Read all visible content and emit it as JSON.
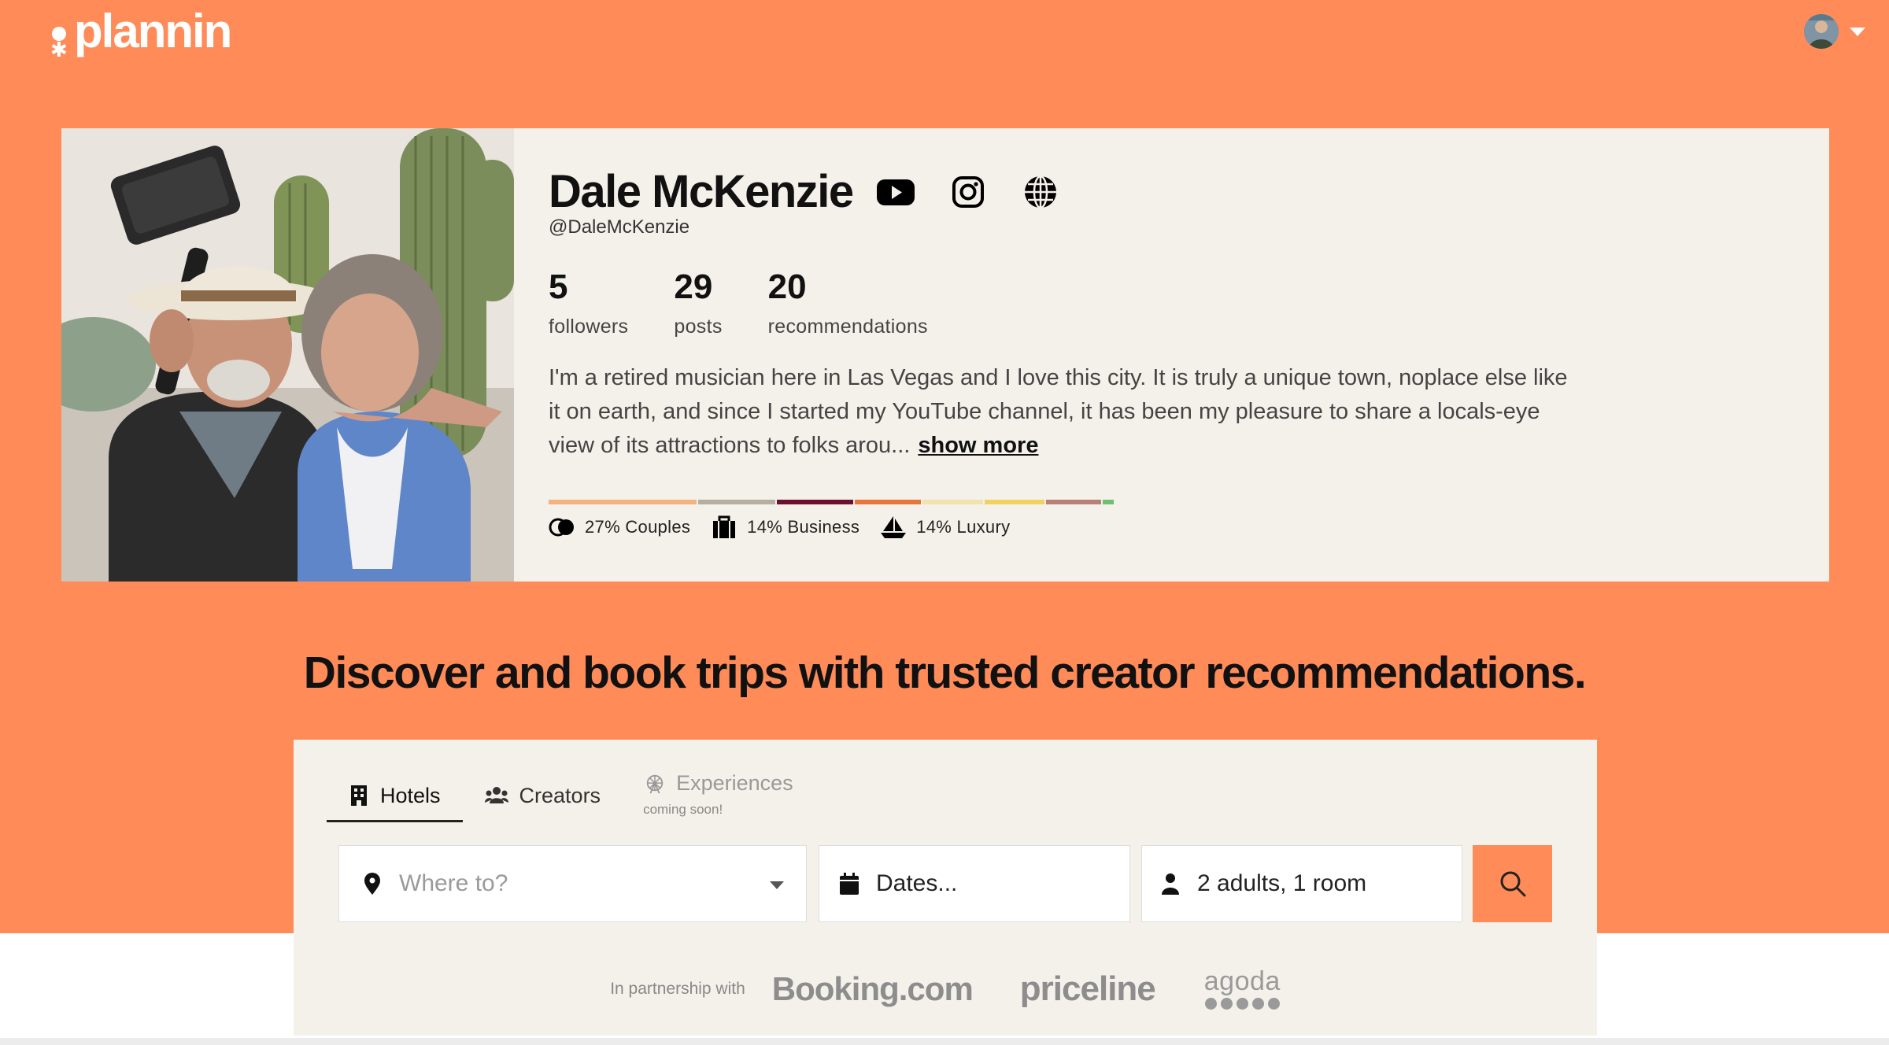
{
  "brand": {
    "name": "plannin"
  },
  "profile": {
    "name": "Dale McKenzie",
    "handle": "@DaleMcKenzie",
    "stats": [
      {
        "value": "5",
        "label": "followers"
      },
      {
        "value": "29",
        "label": "posts"
      },
      {
        "value": "20",
        "label": "recommendations"
      }
    ],
    "bio": "I'm a retired musician here in Las Vegas and I love this city. It is truly a unique town, noplace else like it on earth, and since I started my YouTube channel, it has been my pleasure to share a locals-eye view of its attractions to folks arou...",
    "show_more": "show more",
    "segments": [
      {
        "color": "#F4B27F",
        "weight": 27
      },
      {
        "color": "#B6ADA3",
        "weight": 14
      },
      {
        "color": "#6B1030",
        "weight": 14
      },
      {
        "color": "#E8753A",
        "weight": 12
      },
      {
        "color": "#F1E2AE",
        "weight": 11
      },
      {
        "color": "#F0D35E",
        "weight": 11
      },
      {
        "color": "#B88078",
        "weight": 10
      },
      {
        "color": "#6CC070",
        "weight": 2
      }
    ],
    "tags": [
      {
        "label": "27% Couples",
        "icon": "couples-icon"
      },
      {
        "label": "14% Business",
        "icon": "briefcase-icon"
      },
      {
        "label": "14% Luxury",
        "icon": "sailboat-icon"
      }
    ]
  },
  "headline": "Discover and book trips with trusted creator recommendations.",
  "search": {
    "tabs": [
      {
        "label": "Hotels",
        "icon": "building-icon",
        "active": true
      },
      {
        "label": "Creators",
        "icon": "people-icon"
      },
      {
        "label": "Experiences",
        "icon": "ferris-wheel-icon",
        "note": "coming soon!"
      }
    ],
    "where_placeholder": "Where to?",
    "dates_label": "Dates...",
    "guests_label": "2 adults, 1 room",
    "partner_label": "In partnership with",
    "partners": [
      "Booking.com",
      "priceline",
      "agoda"
    ]
  },
  "colors": {
    "accent": "#FF8B59",
    "card": "#F4F1EA"
  }
}
